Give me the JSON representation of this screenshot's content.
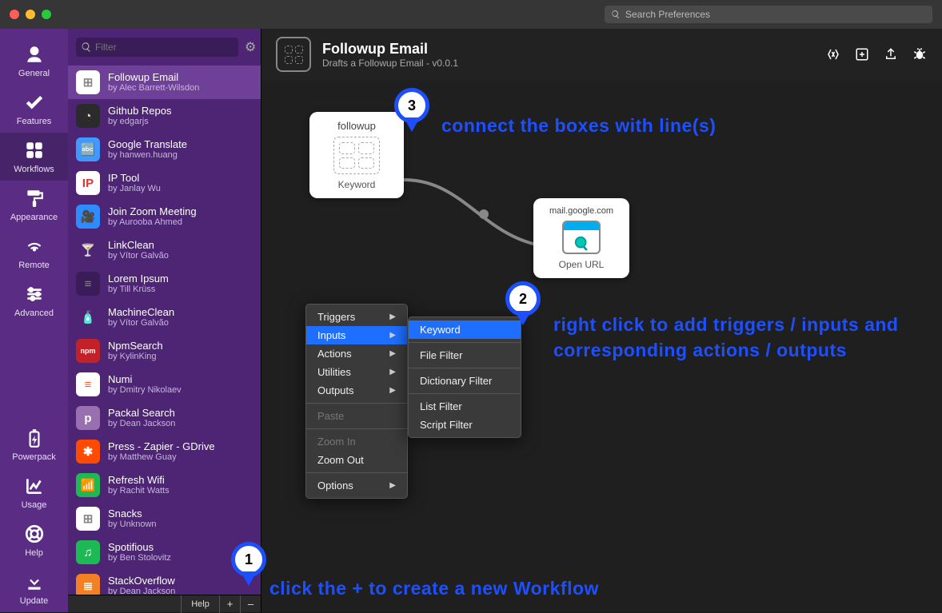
{
  "titlebar": {
    "search_placeholder": "Search Preferences"
  },
  "sidebar": {
    "items": [
      {
        "label": "General",
        "icon": "person-icon"
      },
      {
        "label": "Features",
        "icon": "check-icon"
      },
      {
        "label": "Workflows",
        "icon": "grid-icon",
        "active": true
      },
      {
        "label": "Appearance",
        "icon": "paint-roller-icon"
      },
      {
        "label": "Remote",
        "icon": "broadcast-icon"
      },
      {
        "label": "Advanced",
        "icon": "sliders-icon"
      }
    ],
    "bottom": [
      {
        "label": "Powerpack",
        "icon": "battery-icon"
      },
      {
        "label": "Usage",
        "icon": "chart-icon"
      },
      {
        "label": "Help",
        "icon": "lifebuoy-icon"
      },
      {
        "label": "Update",
        "icon": "download-icon"
      }
    ]
  },
  "wf_filter_placeholder": "Filter",
  "workflows": [
    {
      "name": "Followup Email",
      "author": "by Alec Barrett-Wilsdon",
      "selected": true,
      "bg": "#fff",
      "fg": "#888",
      "glyph": "⊞"
    },
    {
      "name": "Github Repos",
      "author": "by edgarjs",
      "bg": "#2b2b2b",
      "fg": "#ddd",
      "glyph": "◔"
    },
    {
      "name": "Google Translate",
      "author": "by hanwen.huang",
      "bg": "#4099ff",
      "fg": "#fff",
      "glyph": "🔤"
    },
    {
      "name": "IP Tool",
      "author": "by Janlay Wu",
      "bg": "#fff",
      "fg": "#d33",
      "glyph": "IP"
    },
    {
      "name": "Join Zoom Meeting",
      "author": "by Aurooba Ahmed",
      "bg": "#2d8cff",
      "fg": "#fff",
      "glyph": "🎥"
    },
    {
      "name": "LinkClean",
      "author": "by Vítor Galvão",
      "bg": "transparent",
      "fg": "#ffd04b",
      "glyph": "🍸"
    },
    {
      "name": "Lorem Ipsum",
      "author": "by Till Krüss",
      "bg": "#3a1d58",
      "fg": "#888",
      "glyph": "≡"
    },
    {
      "name": "MachineClean",
      "author": "by Vítor Galvão",
      "bg": "transparent",
      "fg": "#77dd44",
      "glyph": "🧴"
    },
    {
      "name": "NpmSearch",
      "author": "by KylinKing",
      "bg": "#c12127",
      "fg": "#fff",
      "glyph": "npm"
    },
    {
      "name": "Numi",
      "author": "by Dmitry Nikolaev",
      "bg": "#fff",
      "fg": "#ff5a36",
      "glyph": "≡"
    },
    {
      "name": "Packal Search",
      "author": "by Dean Jackson",
      "bg": "#9a6fb0",
      "fg": "#fff",
      "glyph": "p"
    },
    {
      "name": "Press - Zapier - GDrive",
      "author": "by Matthew Guay",
      "bg": "#ff4a00",
      "fg": "#fff",
      "glyph": "✱"
    },
    {
      "name": "Refresh Wifi",
      "author": "by Rachit Watts",
      "bg": "#1db954",
      "fg": "#fff",
      "glyph": "📶"
    },
    {
      "name": "Snacks",
      "author": "by Unknown",
      "bg": "#fff",
      "fg": "#888",
      "glyph": "⊞"
    },
    {
      "name": "Spotifious",
      "author": "by Ben Stolovitz",
      "bg": "#1db954",
      "fg": "#fff",
      "glyph": "♫"
    },
    {
      "name": "StackOverflow",
      "author": "by Dean Jackson",
      "bg": "#f48024",
      "fg": "#fff",
      "glyph": "≣"
    }
  ],
  "wf_bottom": {
    "help": "Help",
    "plus": "+",
    "minus": "–"
  },
  "header": {
    "title": "Followup Email",
    "subtitle": "Drafts a Followup Email - v0.0.1"
  },
  "canvas": {
    "node1": {
      "top": "followup",
      "bottom": "Keyword"
    },
    "node2": {
      "top": "mail.google.com",
      "bottom": "Open URL"
    }
  },
  "ctx_main": [
    {
      "label": "Triggers",
      "arrow": true
    },
    {
      "label": "Inputs",
      "arrow": true,
      "hover": true
    },
    {
      "label": "Actions",
      "arrow": true
    },
    {
      "label": "Utilities",
      "arrow": true
    },
    {
      "label": "Outputs",
      "arrow": true
    },
    {
      "sep": true
    },
    {
      "label": "Paste",
      "disabled": true
    },
    {
      "sep": true
    },
    {
      "label": "Zoom In",
      "disabled": true
    },
    {
      "label": "Zoom Out"
    },
    {
      "sep": true
    },
    {
      "label": "Options",
      "arrow": true
    }
  ],
  "ctx_sub": [
    {
      "label": "Keyword",
      "hover": true
    },
    {
      "sep": true
    },
    {
      "label": "File Filter"
    },
    {
      "sep": true
    },
    {
      "label": "Dictionary Filter"
    },
    {
      "sep": true
    },
    {
      "label": "List Filter"
    },
    {
      "label": "Script Filter"
    }
  ],
  "annotations": {
    "a1": "click the + to create a new Workflow",
    "a2": "right click to add triggers / inputs and corresponding actions / outputs",
    "a3": "connect the boxes with line(s)",
    "b1": "1",
    "b2": "2",
    "b3": "3"
  }
}
